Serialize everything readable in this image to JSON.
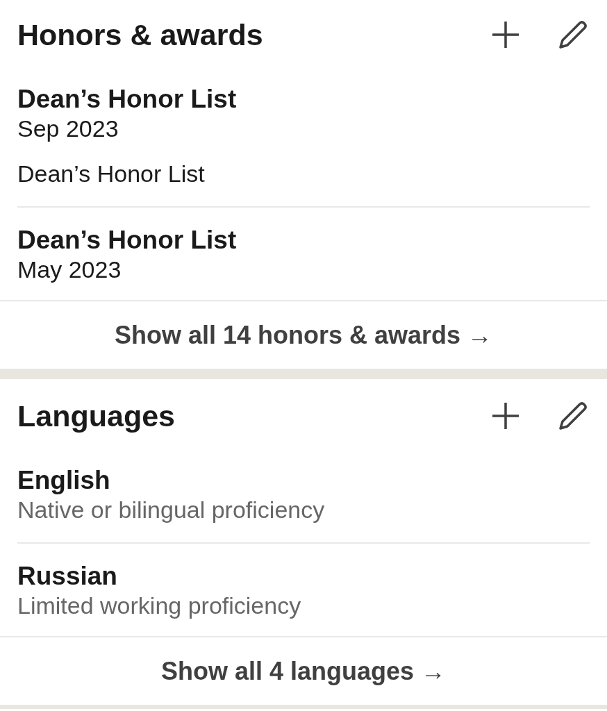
{
  "sections": [
    {
      "title": "Honors & awards",
      "items": [
        {
          "title": "Dean’s Honor List",
          "date": "Sep 2023",
          "description": "Dean’s Honor List"
        },
        {
          "title": "Dean’s Honor List",
          "date": "May 2023"
        }
      ],
      "show_all": "Show all 14 honors & awards →"
    },
    {
      "title": "Languages",
      "items": [
        {
          "title": "English",
          "proficiency": "Native or bilingual proficiency"
        },
        {
          "title": "Russian",
          "proficiency": "Limited working proficiency"
        }
      ],
      "show_all": "Show all 4 languages →"
    }
  ]
}
